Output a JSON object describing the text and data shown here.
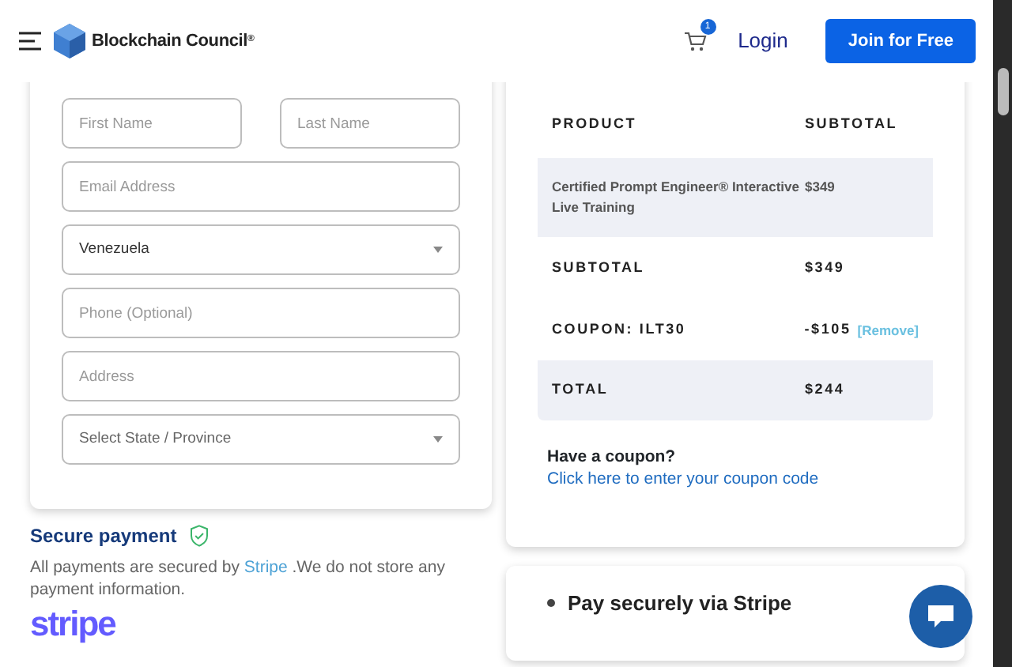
{
  "header": {
    "brand": "Blockchain Council",
    "brand_mark": "®",
    "cart_count": "1",
    "login": "Login",
    "join": "Join for Free"
  },
  "form": {
    "rows": [
      [
        {
          "kind": "input",
          "placeholder": "First Name"
        },
        {
          "kind": "input",
          "placeholder": "Last Name"
        }
      ],
      [
        {
          "kind": "input",
          "placeholder": "Email Address"
        }
      ],
      [
        {
          "kind": "select",
          "value": "Venezuela"
        }
      ],
      [
        {
          "kind": "input",
          "placeholder": "Phone (Optional)"
        }
      ],
      [
        {
          "kind": "input",
          "placeholder": "Address"
        }
      ],
      [
        {
          "kind": "select",
          "placeholder": "Select State / Province"
        }
      ]
    ]
  },
  "secure": {
    "title": "Secure payment",
    "text_before": "All payments are secured by",
    "link": "Stripe",
    "text_after": ".We do not store any payment information.",
    "logo": "stripe"
  },
  "order": {
    "columns": [
      "PRODUCT",
      "SUBTOTAL"
    ],
    "rows": [
      {
        "kind": "item",
        "label": "Certified Prompt Engineer® Interactive Live Training",
        "value": "$349"
      },
      {
        "kind": "summary",
        "label": "SUBTOTAL",
        "value": "$349"
      },
      {
        "kind": "coupon",
        "label": "COUPON: ILT30",
        "value": "-$105",
        "action": "[Remove]"
      },
      {
        "kind": "total",
        "label": "TOTAL",
        "value": "$244"
      }
    ],
    "coupon_question": "Have a coupon?",
    "coupon_link": "Click here to enter your coupon code"
  },
  "payment": {
    "title": "Pay securely via Stripe"
  }
}
